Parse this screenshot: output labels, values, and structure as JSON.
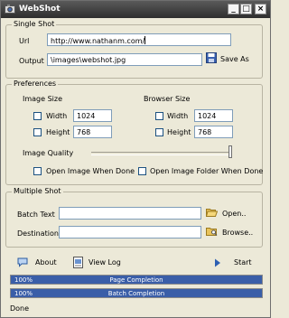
{
  "window": {
    "title": "WebShot"
  },
  "single_shot": {
    "legend": "Single Shot",
    "url_label": "Url",
    "url_value": "http://www.nathanm.com/",
    "output_label": "Output",
    "output_value": "\\images\\webshot.jpg",
    "save_as_label": "Save As"
  },
  "preferences": {
    "legend": "Preferences",
    "image_size": {
      "title": "Image Size",
      "width_label": "Width",
      "width_value": "1024",
      "height_label": "Height",
      "height_value": "768",
      "width_checked": false,
      "height_checked": false
    },
    "browser_size": {
      "title": "Browser Size",
      "width_label": "Width",
      "width_value": "1024",
      "height_label": "Height",
      "height_value": "768",
      "width_checked": false,
      "height_checked": false
    },
    "image_quality_label": "Image Quality",
    "image_quality_level": 1.0,
    "open_image_label": "Open Image When Done",
    "open_image_checked": false,
    "open_folder_label": "Open Image Folder When Done",
    "open_folder_checked": false
  },
  "multiple_shot": {
    "legend": "Multiple Shot",
    "batch_text_label": "Batch Text",
    "batch_text_value": "",
    "open_label": "Open..",
    "destination_label": "Destination",
    "destination_value": "",
    "browse_label": "Browse.."
  },
  "toolbar": {
    "about_label": "About",
    "view_log_label": "View Log",
    "start_label": "Start"
  },
  "progress": {
    "page": {
      "percent_text": "100%",
      "label": "Page Completion",
      "fraction": 1.0
    },
    "batch": {
      "percent_text": "100%",
      "label": "Batch Completion",
      "fraction": 1.0
    }
  },
  "status_text": "Done",
  "colors": {
    "progress_fill": "#3a5ea8",
    "titlebar": "#3a3a3a",
    "input_border": "#7f9db9"
  }
}
